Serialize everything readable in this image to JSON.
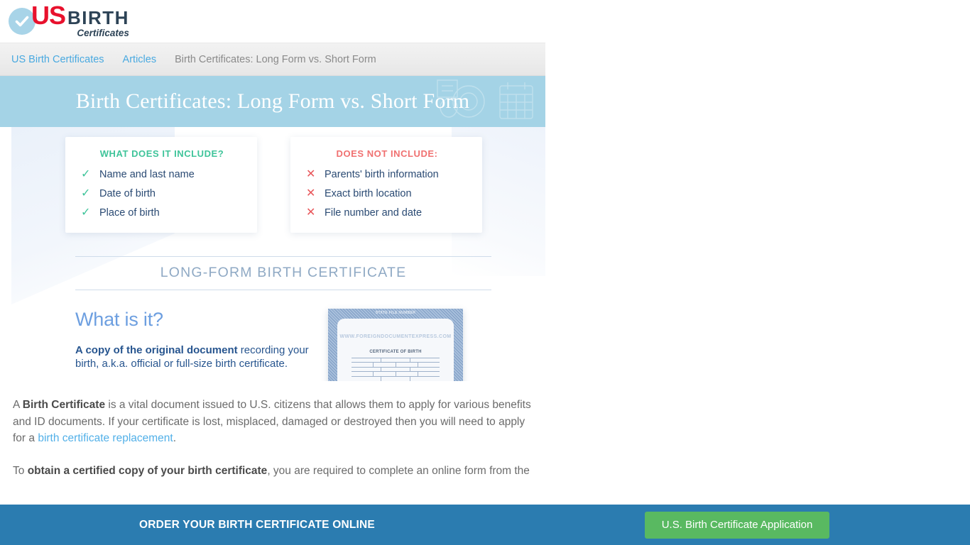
{
  "site": {
    "logo": {
      "check_icon": "check-circle-icon",
      "us": "US",
      "birth": "BIRTH",
      "certificates": "Certificates"
    }
  },
  "breadcrumb": {
    "home_label": "US Birth Certificates",
    "section_label": "Articles",
    "current_label": "Birth Certificates: Long Form vs. Short Form"
  },
  "hero": {
    "title": "Birth Certificates: Long Form vs. Short Form",
    "background_color": "#a4d3e6",
    "deco_icon": "calendar-icon"
  },
  "infographic": {
    "include_card": {
      "heading": "WHAT DOES IT INCLUDE?",
      "heading_color": "#3fc49a",
      "mark_icon": "check-icon",
      "items": [
        "Name and last name",
        "Date of birth",
        "Place of birth"
      ]
    },
    "exclude_card": {
      "heading": "DOES NOT INCLUDE:",
      "heading_color": "#f07171",
      "mark_icon": "cross-icon",
      "items": [
        "Parents' birth information",
        "Exact birth location",
        "File number and date"
      ]
    },
    "section_title": "LONG-FORM BIRTH CERTIFICATE",
    "whatis": {
      "title": "What is it?",
      "bold_lead": "A copy of the original document",
      "rest": " recording your birth, a.k.a. official or full-size birth certificate."
    },
    "certificate_image": {
      "name": "sample-birth-certificate",
      "watermark": "WWW.FOREIGNDOCUMENTEXPRESS.COM",
      "top_text": "STATE FILE NUMBER",
      "title": "CERTIFICATE OF BIRTH"
    }
  },
  "article": {
    "paragraph1": {
      "lead": "A ",
      "bold1": "Birth Certificate",
      "mid": " is a vital document issued to U.S. citizens that allows them to apply for various benefits and ID documents. If your certificate is lost, misplaced, damaged or destroyed then you will need to apply for a ",
      "link": "birth certificate replacement",
      "tail": "."
    },
    "paragraph2": {
      "lead": "To ",
      "bold1": "obtain a certified copy of your birth certificate",
      "tail": ", you are required to complete an online form from the"
    }
  },
  "sticky_cta": {
    "text": "ORDER YOUR BIRTH CERTIFICATE ONLINE",
    "button_label": "U.S. Birth Certificate Application",
    "bar_color": "#2b7cb0",
    "button_color": "#59b961"
  }
}
